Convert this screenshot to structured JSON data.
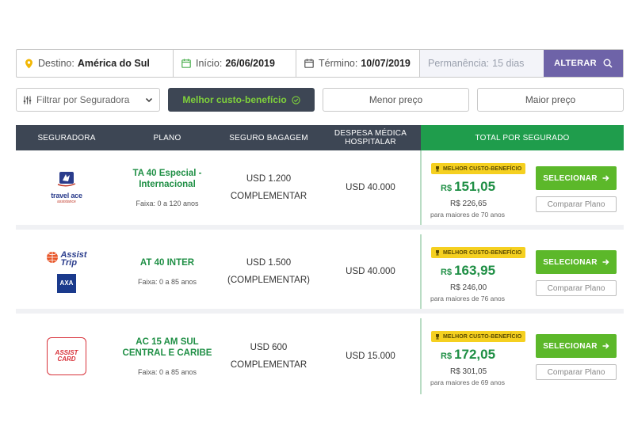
{
  "search": {
    "destino_label": "Destino:",
    "destino_value": "América do Sul",
    "inicio_label": "Início:",
    "inicio_value": "26/06/2019",
    "termino_label": "Término:",
    "termino_value": "10/07/2019",
    "permanencia_label": "Permanência:",
    "permanencia_value": "15 dias",
    "alterar_label": "ALTERAR"
  },
  "filters": {
    "seguradora_placeholder": "Filtrar por Seguradora",
    "best_label": "Melhor custo-benefício",
    "menor_label": "Menor preço",
    "maior_label": "Maior preço"
  },
  "table_header": {
    "seguradora": "SEGURADORA",
    "plano": "PLANO",
    "bagagem": "SEGURO BAGAGEM",
    "despesa_l1": "DESPESA MÉDICA",
    "despesa_l2": "HOSPITALAR",
    "total": "TOTAL POR SEGURADO"
  },
  "rows": [
    {
      "logo": {
        "name": "travelace",
        "text": "travel ace",
        "sub": "assistance"
      },
      "plan_l1": "TA 40 Especial -",
      "plan_l2": "Internacional",
      "faixa": "Faixa: 0 a 120 anos",
      "bag_l1": "USD 1.200",
      "bag_l2": "COMPLEMENTAR",
      "despesa": "USD 40.000",
      "badge": "MELHOR CUSTO-BENEFÍCIO",
      "currency": "R$",
      "price": "151,05",
      "old_price": "R$ 226,65",
      "note": "para maiores de 70 anos",
      "select": "SELECIONAR",
      "compare": "Comparar Plano"
    },
    {
      "logo": {
        "name": "assist-trip",
        "text_a": "Assist",
        "text_b": "Trip",
        "axa": "AXA"
      },
      "plan_l1": "AT 40 INTER",
      "plan_l2": "",
      "faixa": "Faixa: 0 a 85 anos",
      "bag_l1": "USD 1.500",
      "bag_l2": "(COMPLEMENTAR)",
      "despesa": "USD 40.000",
      "badge": "MELHOR CUSTO-BENEFÍCIO",
      "currency": "R$",
      "price": "163,95",
      "old_price": "R$ 246,00",
      "note": "para maiores de 76 anos",
      "select": "SELECIONAR",
      "compare": "Comparar Plano"
    },
    {
      "logo": {
        "name": "assist-card",
        "text_a": "ASSIST",
        "text_b": "CARD"
      },
      "plan_l1": "AC 15 AM SUL",
      "plan_l2": "CENTRAL E CARIBE",
      "faixa": "Faixa: 0 a 85 anos",
      "bag_l1": "USD 600",
      "bag_l2": "COMPLEMENTAR",
      "despesa": "USD 15.000",
      "badge": "MELHOR CUSTO-BENEFÍCIO",
      "currency": "R$",
      "price": "172,05",
      "old_price": "R$ 301,05",
      "note": "para maiores de 69 anos",
      "select": "SELECIONAR",
      "compare": "Comparar Plano"
    }
  ],
  "colors": {
    "header_dark": "#3d4654",
    "header_green": "#1f9d4c",
    "accent_purple": "#6e63a8",
    "plan_green": "#1f8f45",
    "button_green": "#5cb82a",
    "badge_yellow": "#f5d020"
  }
}
